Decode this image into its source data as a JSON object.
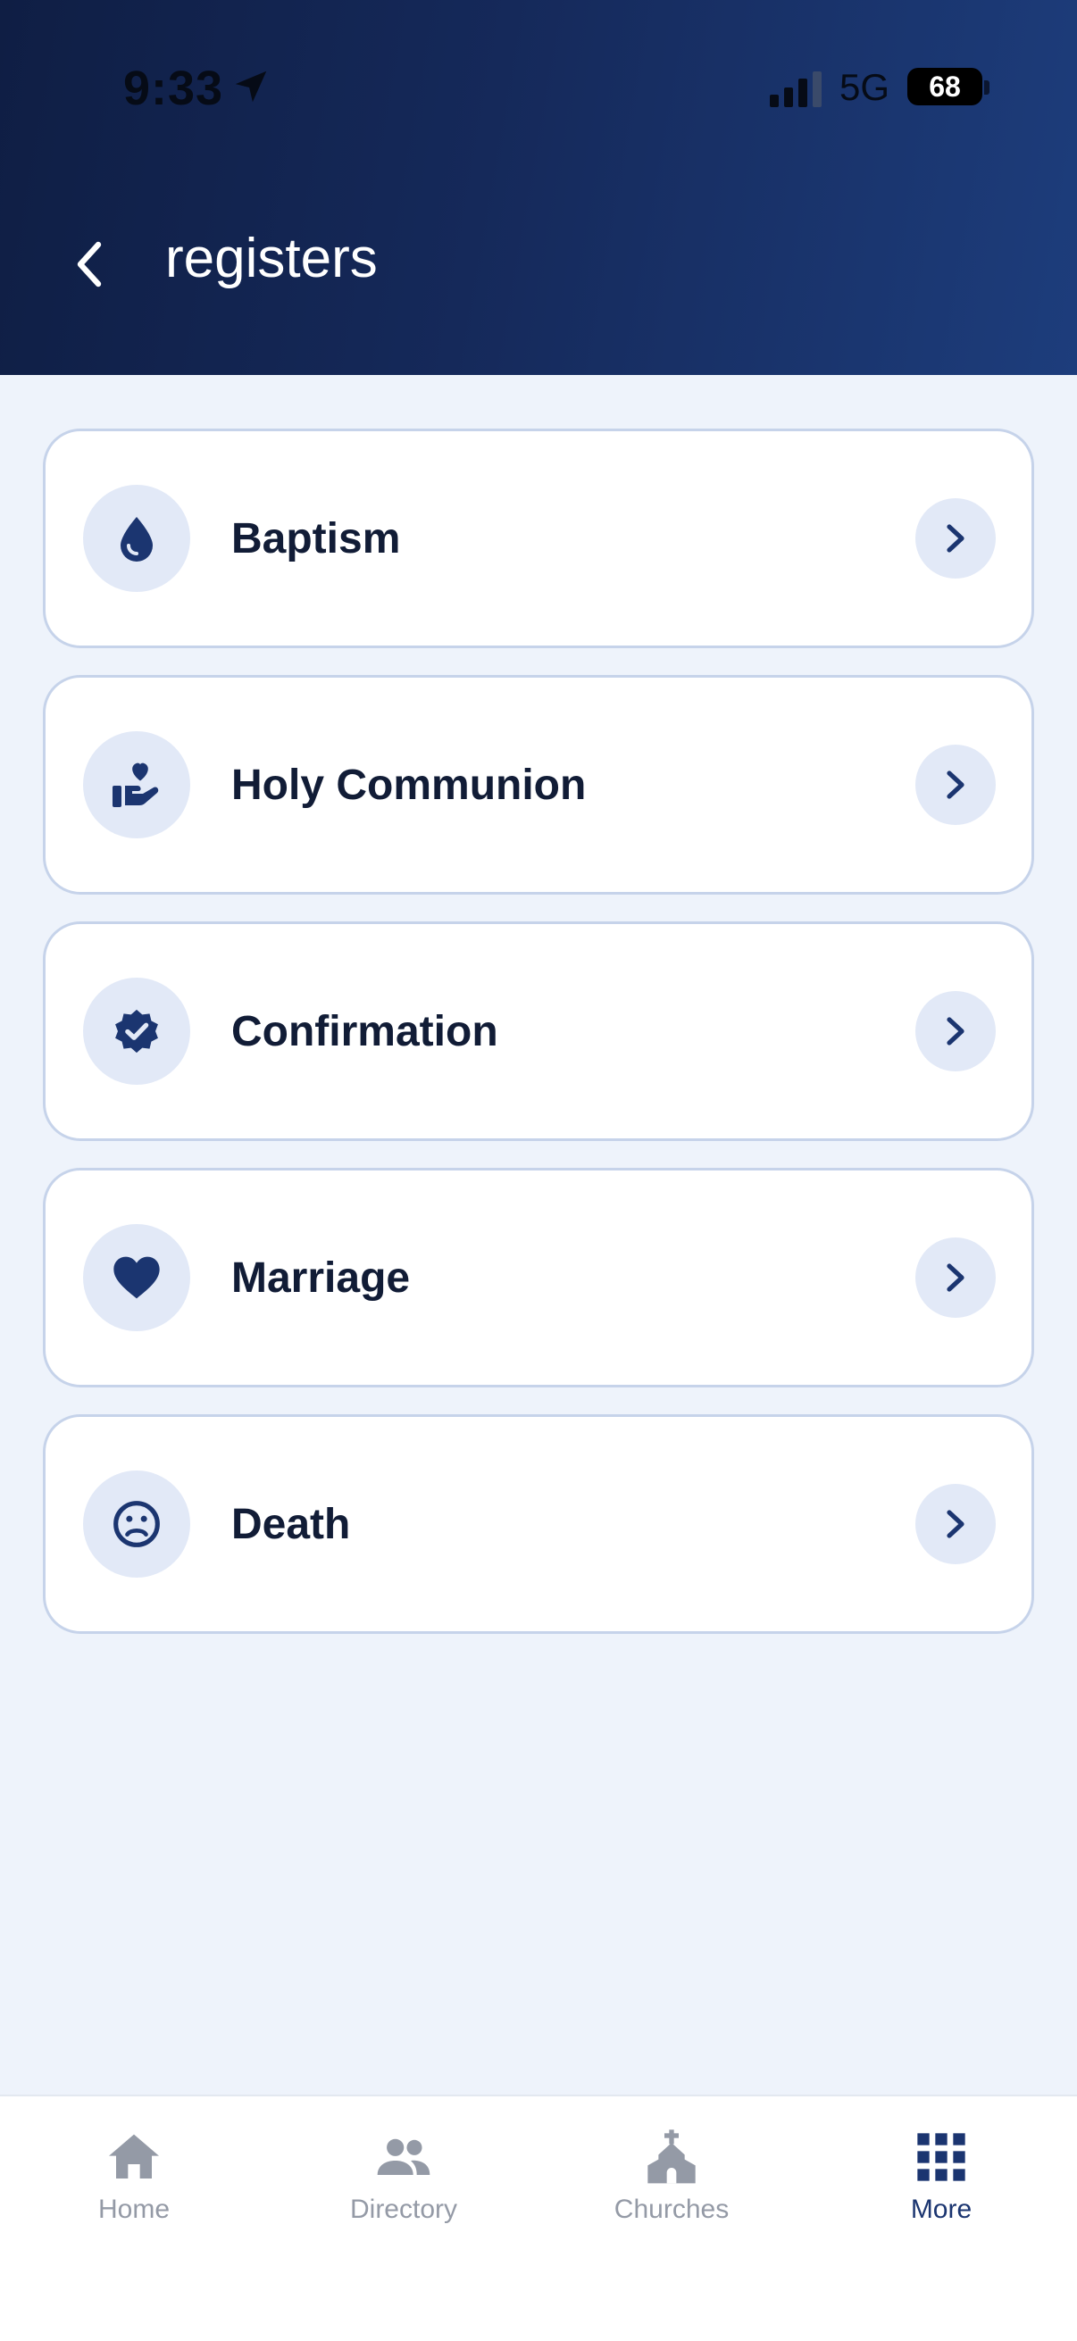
{
  "status_bar": {
    "time": "9:33",
    "network": "5G",
    "battery": "68"
  },
  "header": {
    "title": "registers"
  },
  "registers": [
    {
      "label": "Baptism",
      "icon": "water-drop-icon"
    },
    {
      "label": "Holy Communion",
      "icon": "hand-heart-icon"
    },
    {
      "label": "Confirmation",
      "icon": "verified-badge-icon"
    },
    {
      "label": "Marriage",
      "icon": "heart-icon"
    },
    {
      "label": "Death",
      "icon": "sad-face-icon"
    }
  ],
  "tabs": [
    {
      "label": "Home",
      "icon": "home-icon",
      "active": false
    },
    {
      "label": "Directory",
      "icon": "people-icon",
      "active": false
    },
    {
      "label": "Churches",
      "icon": "church-icon",
      "active": false
    },
    {
      "label": "More",
      "icon": "grid-icon",
      "active": true
    }
  ],
  "colors": {
    "header_start": "#0f1e44",
    "header_end": "#1d3d7c",
    "accent": "#1b3570",
    "background": "#eef3fb",
    "card_border": "#c6d3ea",
    "icon_circle": "#e2e9f7",
    "tab_inactive": "#949aa6"
  }
}
